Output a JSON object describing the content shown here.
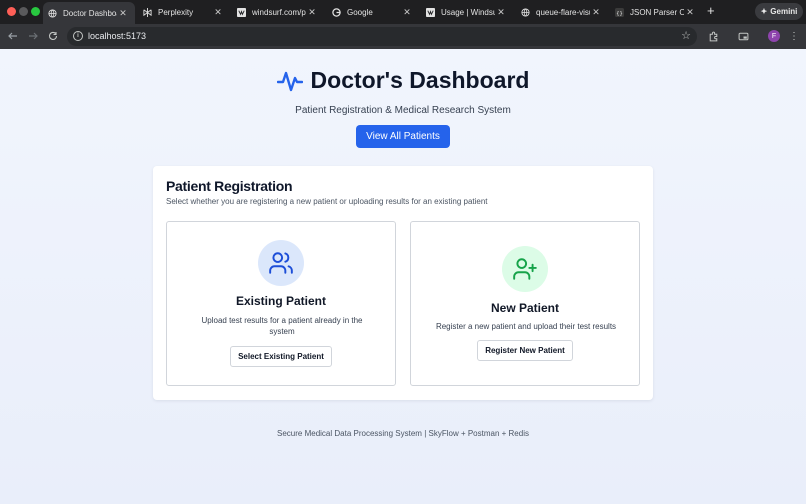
{
  "browser": {
    "tabs": [
      {
        "title": "Doctor Dashboard",
        "icon": "globe-icon",
        "active": true
      },
      {
        "title": "Perplexity",
        "icon": "perplexity-icon",
        "active": false
      },
      {
        "title": "windsurf.com/pr",
        "icon": "windsurf-icon",
        "active": false
      },
      {
        "title": "Google",
        "icon": "google-icon",
        "active": false
      },
      {
        "title": "Usage | Windsurf",
        "icon": "windsurf-icon",
        "active": false
      },
      {
        "title": "queue-flare-visu",
        "icon": "globe-icon",
        "active": false
      },
      {
        "title": "JSON Parser Onl",
        "icon": "json-icon",
        "active": false
      }
    ],
    "new_tab": "+",
    "gemini_label": "Gemini",
    "url": "localhost:5173",
    "profile_initial": "F"
  },
  "header": {
    "title": "Doctor's Dashboard",
    "subtitle": "Patient Registration & Medical Research System",
    "view_all_label": "View All Patients"
  },
  "registration": {
    "title": "Patient Registration",
    "description": "Select whether you are registering a new patient or uploading results for an existing patient",
    "existing": {
      "title": "Existing Patient",
      "description": "Upload test results for a patient already in the system",
      "button": "Select Existing Patient",
      "icon": "users-icon"
    },
    "new": {
      "title": "New Patient",
      "description": "Register a new patient and upload their test results",
      "button": "Register New Patient",
      "icon": "user-plus-icon"
    }
  },
  "footer": "Secure Medical Data Processing System | SkyFlow + Postman + Redis",
  "colors": {
    "primary": "#2563eb",
    "icon_blue": "#1d4ed8",
    "icon_green": "#16a34a"
  }
}
